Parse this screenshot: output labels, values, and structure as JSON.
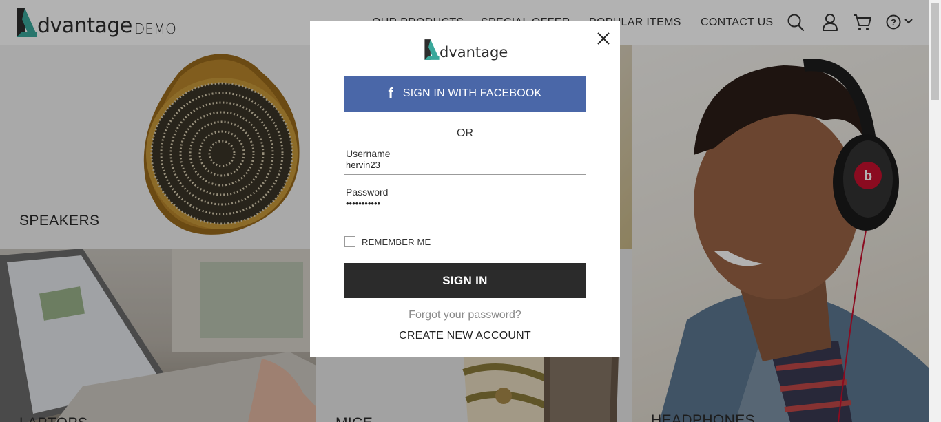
{
  "header": {
    "logo_word": "dvantage",
    "logo_sub": "DEMO",
    "nav": [
      "OUR PRODUCTS",
      "SPECIAL OFFER",
      "POPULAR ITEMS",
      "CONTACT US"
    ],
    "icons": [
      "search-icon",
      "user-icon",
      "cart-icon",
      "help-icon",
      "chevron-down-icon"
    ]
  },
  "tiles": {
    "speakers": "SPEAKERS",
    "laptops": "LAPTOPS",
    "mice": "MICE",
    "headphones": "HEADPHONES"
  },
  "modal": {
    "logo_word": "dvantage",
    "facebook_label": "SIGN IN WITH FACEBOOK",
    "facebook_icon": "f",
    "or_text": "OR",
    "username_label": "Username",
    "username_value": "hervin23",
    "password_label": "Password",
    "password_value": "•••••••••••",
    "remember_label": "REMEMBER ME",
    "remember_checked": false,
    "signin_label": "SIGN IN",
    "forgot_label": "Forgot your password?",
    "create_label": "CREATE NEW ACCOUNT"
  },
  "colors": {
    "brand_teal": "#3aa89b",
    "facebook_blue": "#4a67a8",
    "signin_dark": "#2b2b2b"
  }
}
